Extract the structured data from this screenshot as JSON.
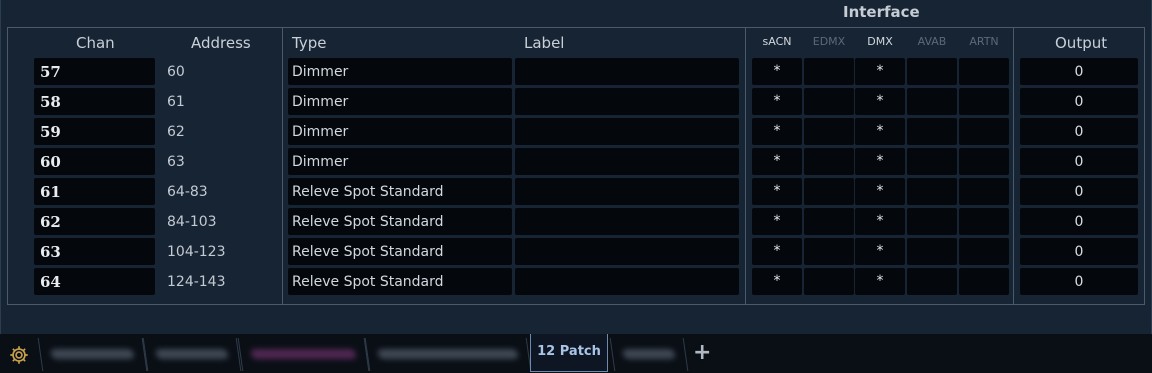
{
  "header": {
    "interface_title": "Interface",
    "columns": {
      "chan": "Chan",
      "address": "Address",
      "type": "Type",
      "label": "Label",
      "output": "Output"
    },
    "interfaces": [
      {
        "label": "sACN",
        "enabled": true
      },
      {
        "label": "EDMX",
        "enabled": false
      },
      {
        "label": "DMX",
        "enabled": true
      },
      {
        "label": "AVAB",
        "enabled": false
      },
      {
        "label": "ARTN",
        "enabled": false
      }
    ]
  },
  "rows": [
    {
      "chan": "57",
      "address": "60",
      "type": "Dimmer",
      "label": "",
      "iface": [
        "*",
        "",
        "*",
        "",
        ""
      ],
      "output": "0"
    },
    {
      "chan": "58",
      "address": "61",
      "type": "Dimmer",
      "label": "",
      "iface": [
        "*",
        "",
        "*",
        "",
        ""
      ],
      "output": "0"
    },
    {
      "chan": "59",
      "address": "62",
      "type": "Dimmer",
      "label": "",
      "iface": [
        "*",
        "",
        "*",
        "",
        ""
      ],
      "output": "0"
    },
    {
      "chan": "60",
      "address": "63",
      "type": "Dimmer",
      "label": "",
      "iface": [
        "*",
        "",
        "*",
        "",
        ""
      ],
      "output": "0"
    },
    {
      "chan": "61",
      "address": "64-83",
      "type": "Releve Spot Standard",
      "label": "",
      "iface": [
        "*",
        "",
        "*",
        "",
        ""
      ],
      "output": "0"
    },
    {
      "chan": "62",
      "address": "84-103",
      "type": "Releve Spot Standard",
      "label": "",
      "iface": [
        "*",
        "",
        "*",
        "",
        ""
      ],
      "output": "0"
    },
    {
      "chan": "63",
      "address": "104-123",
      "type": "Releve Spot Standard",
      "label": "",
      "iface": [
        "*",
        "",
        "*",
        "",
        ""
      ],
      "output": "0"
    },
    {
      "chan": "64",
      "address": "124-143",
      "type": "Releve Spot Standard",
      "label": "",
      "iface": [
        "*",
        "",
        "*",
        "",
        ""
      ],
      "output": "0"
    }
  ],
  "tabs": {
    "active_label": "12 Patch",
    "add_label": "+",
    "blurred_tabs": [
      {
        "color": "#6b7686"
      },
      {
        "color": "#6b7686"
      },
      {
        "color": "#8a3a82"
      },
      {
        "color": "#6b7686"
      },
      {
        "color": "#6b7686"
      }
    ]
  },
  "icons": {
    "settings": "gear-icon"
  },
  "colors": {
    "background": "#172434",
    "cell": "#04080c",
    "active_tab_text": "#a9c4e6",
    "gear": "#c8a24a"
  }
}
